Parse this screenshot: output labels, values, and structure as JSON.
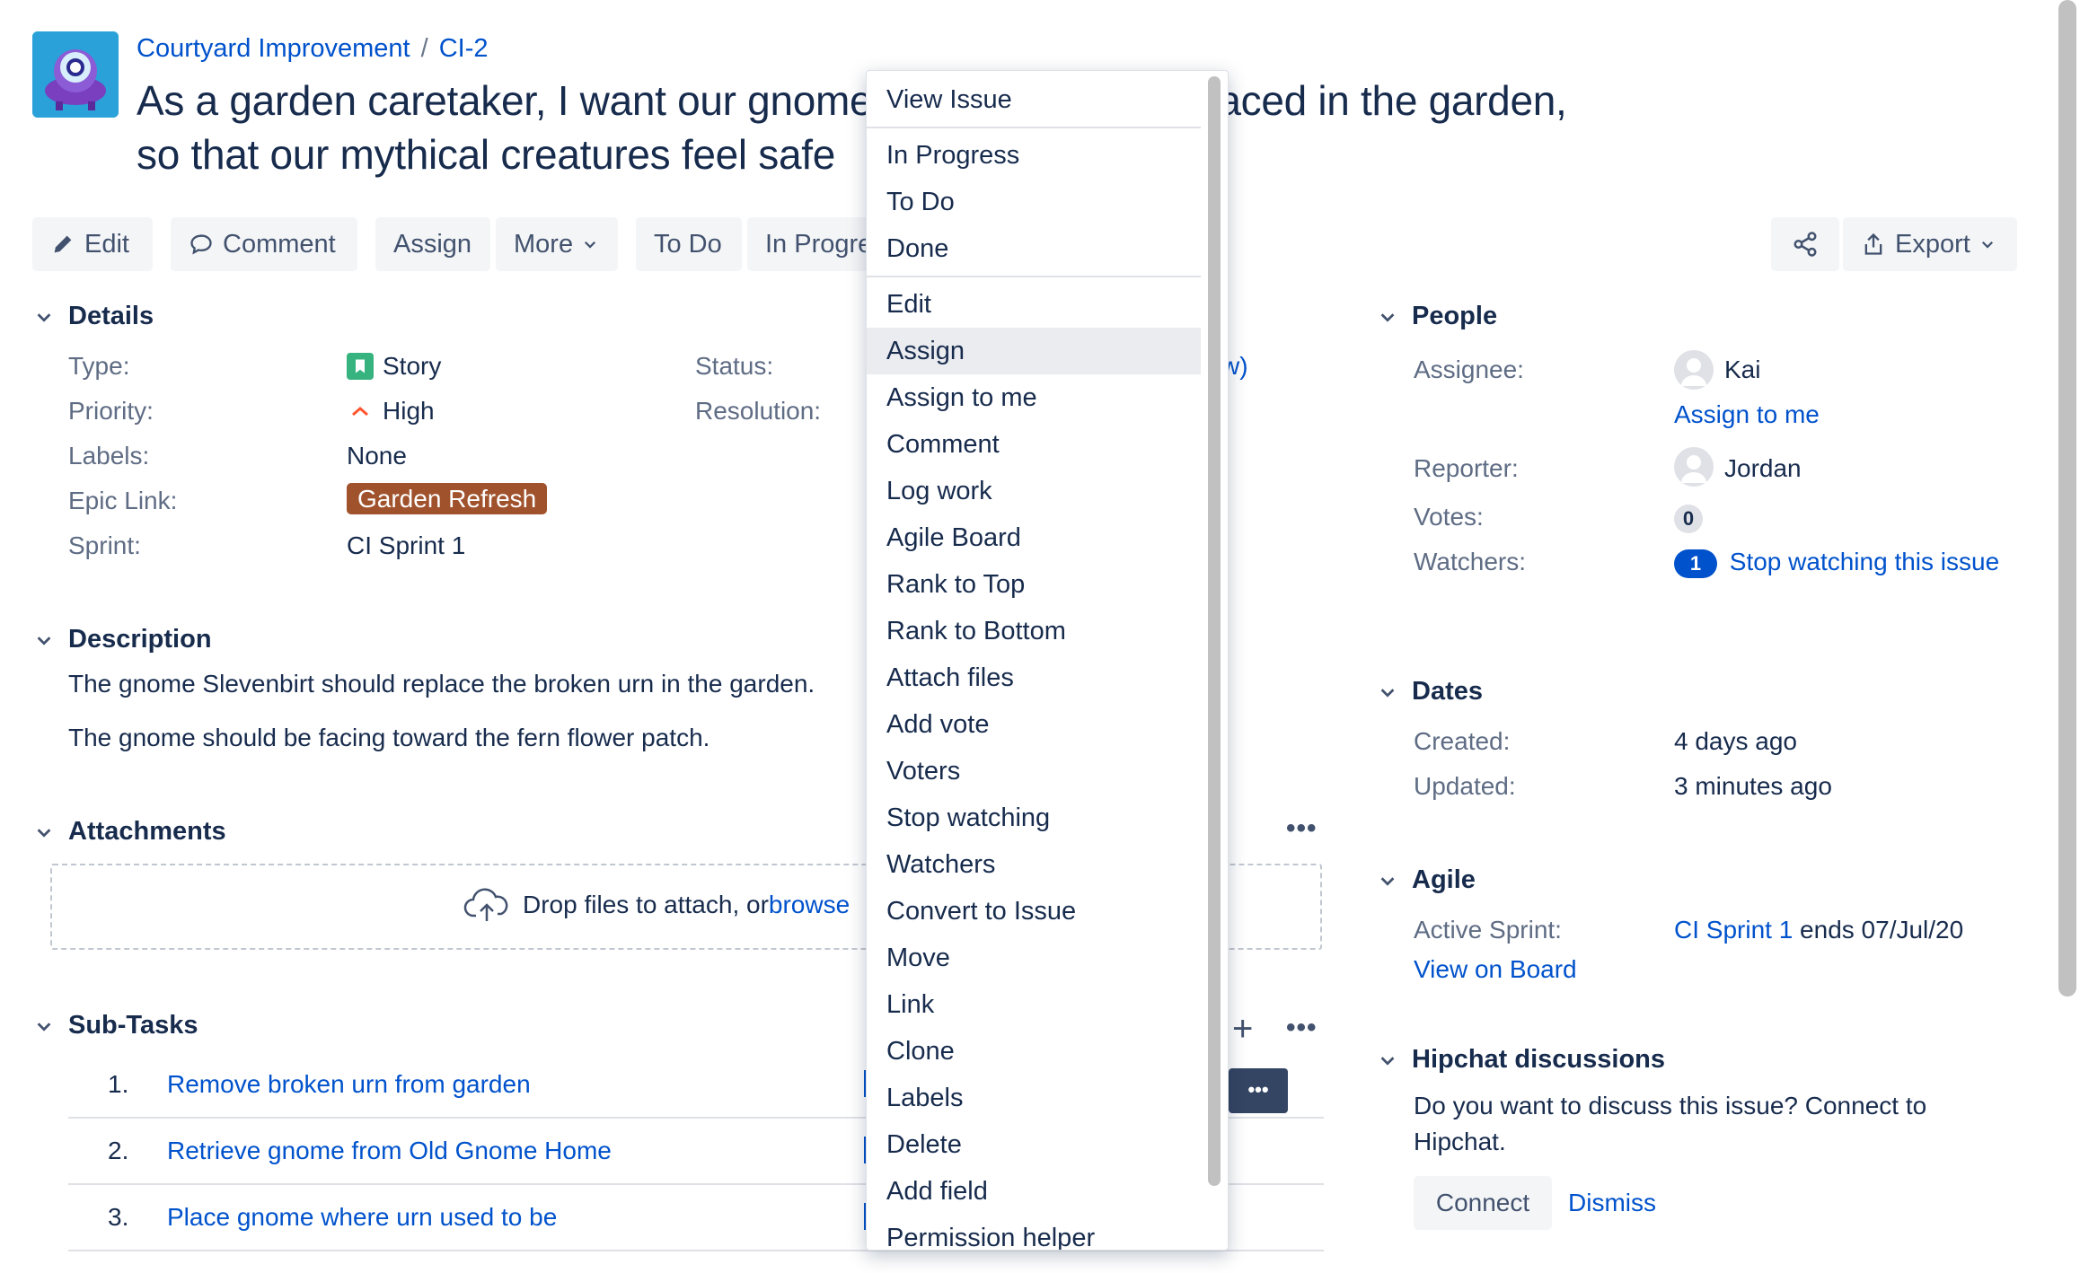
{
  "breadcrumbs": {
    "project": "Courtyard Improvement",
    "separator": "/",
    "issue_key": "CI-2"
  },
  "summary_line1": "As a garden caretaker, I want our gnome",
  "summary_line1_tail": "aced in the garden,",
  "summary_line2": "so that our mythical creatures feel safe",
  "toolbar": {
    "edit": "Edit",
    "comment": "Comment",
    "assign": "Assign",
    "more": "More",
    "todo": "To Do",
    "in_progress": "In Progre",
    "export": "Export"
  },
  "details": {
    "title": "Details",
    "type_label": "Type:",
    "type_value": "Story",
    "priority_label": "Priority:",
    "priority_value": "High",
    "labels_label": "Labels:",
    "labels_value": "None",
    "epic_label": "Epic Link:",
    "epic_value": "Garden Refresh",
    "sprint_label": "Sprint:",
    "sprint_value": "CI Sprint 1",
    "status_label": "Status:",
    "status_fragment": "w)",
    "resolution_label": "Resolution:"
  },
  "description": {
    "title": "Description",
    "line1": "The gnome Slevenbirt should replace the broken urn in the garden.",
    "line2": "The gnome should be facing toward the fern flower patch."
  },
  "attachments": {
    "title": "Attachments",
    "drop_text": "Drop files to attach, or ",
    "browse": "browse"
  },
  "subtasks": {
    "title": "Sub-Tasks",
    "items": [
      {
        "num": "1.",
        "title": "Remove broken urn from garden"
      },
      {
        "num": "2.",
        "title": "Retrieve gnome from Old Gnome Home"
      },
      {
        "num": "3.",
        "title": "Place gnome where urn used to be"
      }
    ]
  },
  "people": {
    "title": "People",
    "assignee_label": "Assignee:",
    "assignee": "Kai",
    "assign_to_me": "Assign to me",
    "reporter_label": "Reporter:",
    "reporter": "Jordan",
    "votes_label": "Votes:",
    "votes": "0",
    "watchers_label": "Watchers:",
    "watchers": "1",
    "stop_watching": "Stop watching this issue"
  },
  "dates": {
    "title": "Dates",
    "created_label": "Created:",
    "created": "4 days ago",
    "updated_label": "Updated:",
    "updated": "3 minutes ago"
  },
  "agile": {
    "title": "Agile",
    "active_sprint_label": "Active Sprint:",
    "sprint": "CI Sprint 1",
    "ends": " ends 07/Jul/20",
    "view_on_board": "View on Board"
  },
  "hipchat": {
    "title": "Hipchat discussions",
    "line1": "Do you want to discuss this issue? Connect to",
    "line2": "Hipchat.",
    "connect": "Connect",
    "dismiss": "Dismiss"
  },
  "menu": {
    "items": [
      "View Issue",
      "In Progress",
      "To Do",
      "Done",
      "Edit",
      "Assign",
      "Assign to me",
      "Comment",
      "Log work",
      "Agile Board",
      "Rank to Top",
      "Rank to Bottom",
      "Attach files",
      "Add vote",
      "Voters",
      "Stop watching",
      "Watchers",
      "Convert to Issue",
      "Move",
      "Link",
      "Clone",
      "Labels",
      "Delete",
      "Add field",
      "Permission helper"
    ],
    "highlighted": "Assign"
  },
  "colors": {
    "link": "#0052cc",
    "text": "#172b4d",
    "muted": "#5e6c84",
    "epic": "#a0522d",
    "story": "#36b37e",
    "priority_high": "#ff5630"
  }
}
